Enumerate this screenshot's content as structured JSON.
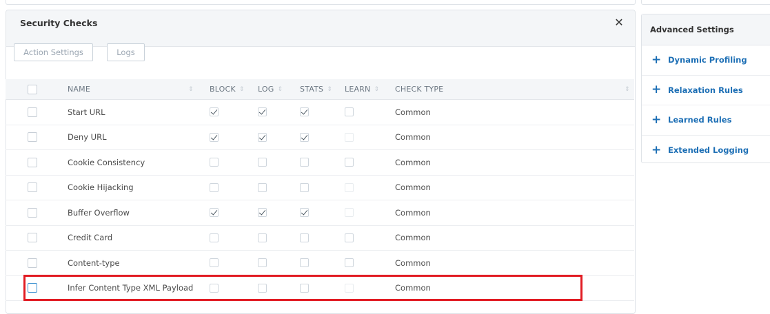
{
  "panel": {
    "title": "Security Checks",
    "close_symbol": "✕"
  },
  "toolbar": {
    "action_settings_label": "Action Settings",
    "logs_label": "Logs"
  },
  "table": {
    "columns": [
      "NAME",
      "BLOCK",
      "LOG",
      "STATS",
      "LEARN",
      "CHECK TYPE"
    ],
    "rows": [
      {
        "name": "Start URL",
        "block": true,
        "log": true,
        "stats": true,
        "learn": false,
        "learn_enabled": true,
        "type": "Common"
      },
      {
        "name": "Deny URL",
        "block": true,
        "log": true,
        "stats": true,
        "learn": false,
        "learn_enabled": false,
        "type": "Common"
      },
      {
        "name": "Cookie Consistency",
        "block": false,
        "log": false,
        "stats": false,
        "learn": false,
        "learn_enabled": true,
        "type": "Common"
      },
      {
        "name": "Cookie Hijacking",
        "block": false,
        "log": false,
        "stats": false,
        "learn": false,
        "learn_enabled": false,
        "type": "Common"
      },
      {
        "name": "Buffer Overflow",
        "block": true,
        "log": true,
        "stats": true,
        "learn": false,
        "learn_enabled": false,
        "type": "Common"
      },
      {
        "name": "Credit Card",
        "block": false,
        "log": false,
        "stats": false,
        "learn": false,
        "learn_enabled": true,
        "type": "Common"
      },
      {
        "name": "Content-type",
        "block": false,
        "log": false,
        "stats": false,
        "learn": false,
        "learn_enabled": true,
        "type": "Common"
      },
      {
        "name": "Infer Content Type XML Payload",
        "block": false,
        "log": false,
        "stats": false,
        "learn": false,
        "learn_enabled": false,
        "type": "Common",
        "highlighted": true
      }
    ]
  },
  "sidebar": {
    "title": "Advanced Settings",
    "items": [
      {
        "label": "Dynamic Profiling"
      },
      {
        "label": "Relaxation Rules"
      },
      {
        "label": "Learned Rules"
      },
      {
        "label": "Extended Logging"
      }
    ]
  },
  "colors": {
    "accent": "#1d6fb5",
    "highlight_border": "#e11b22",
    "header_bg": "#f4f6f8"
  }
}
